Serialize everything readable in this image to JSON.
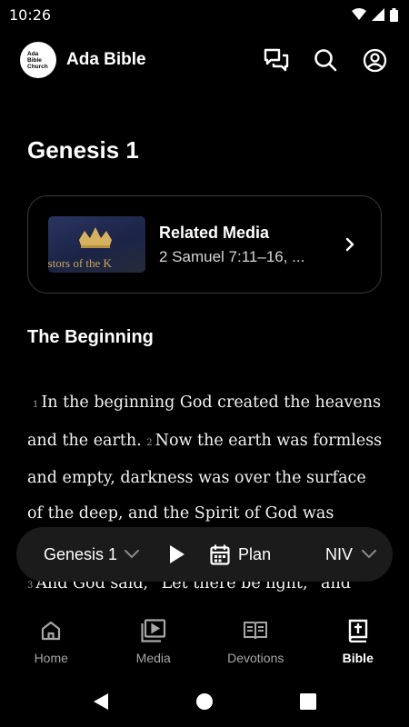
{
  "status": {
    "time": "10:26"
  },
  "header": {
    "logo_lines": [
      "Ada",
      "Bible",
      "Church"
    ],
    "app_name": "Ada Bible",
    "icons": [
      "chat-icon",
      "search-icon",
      "account-icon"
    ]
  },
  "chapter_title": "Genesis 1",
  "related_media": {
    "title": "Related Media",
    "subtitle": "2 Samuel 7:11–16, ...",
    "thumbnail_text": "cestors of the K"
  },
  "section_heading": "The Beginning",
  "verses": [
    {
      "num": "1",
      "text": "In the beginning God created the heavens and the earth."
    },
    {
      "num": "2",
      "text": "Now the earth was formless and empty, darkness was over the surface of the deep, and the Spirit of God was hovering over the waters."
    },
    {
      "num": "3",
      "text": "And God said, “Let there be light,” and"
    }
  ],
  "player": {
    "chapter": "Genesis 1",
    "plan_label": "Plan",
    "version": "NIV"
  },
  "tabs": [
    {
      "label": "Home",
      "icon": "home-icon",
      "active": false
    },
    {
      "label": "Media",
      "icon": "media-icon",
      "active": false
    },
    {
      "label": "Devotions",
      "icon": "book-open-icon",
      "active": false
    },
    {
      "label": "Bible",
      "icon": "bible-icon",
      "active": true
    }
  ],
  "colors": {
    "background": "#000000",
    "card_border": "#3a3a3a",
    "player_bg": "#1b1b1b",
    "inactive_tab": "#a6a6a6"
  }
}
